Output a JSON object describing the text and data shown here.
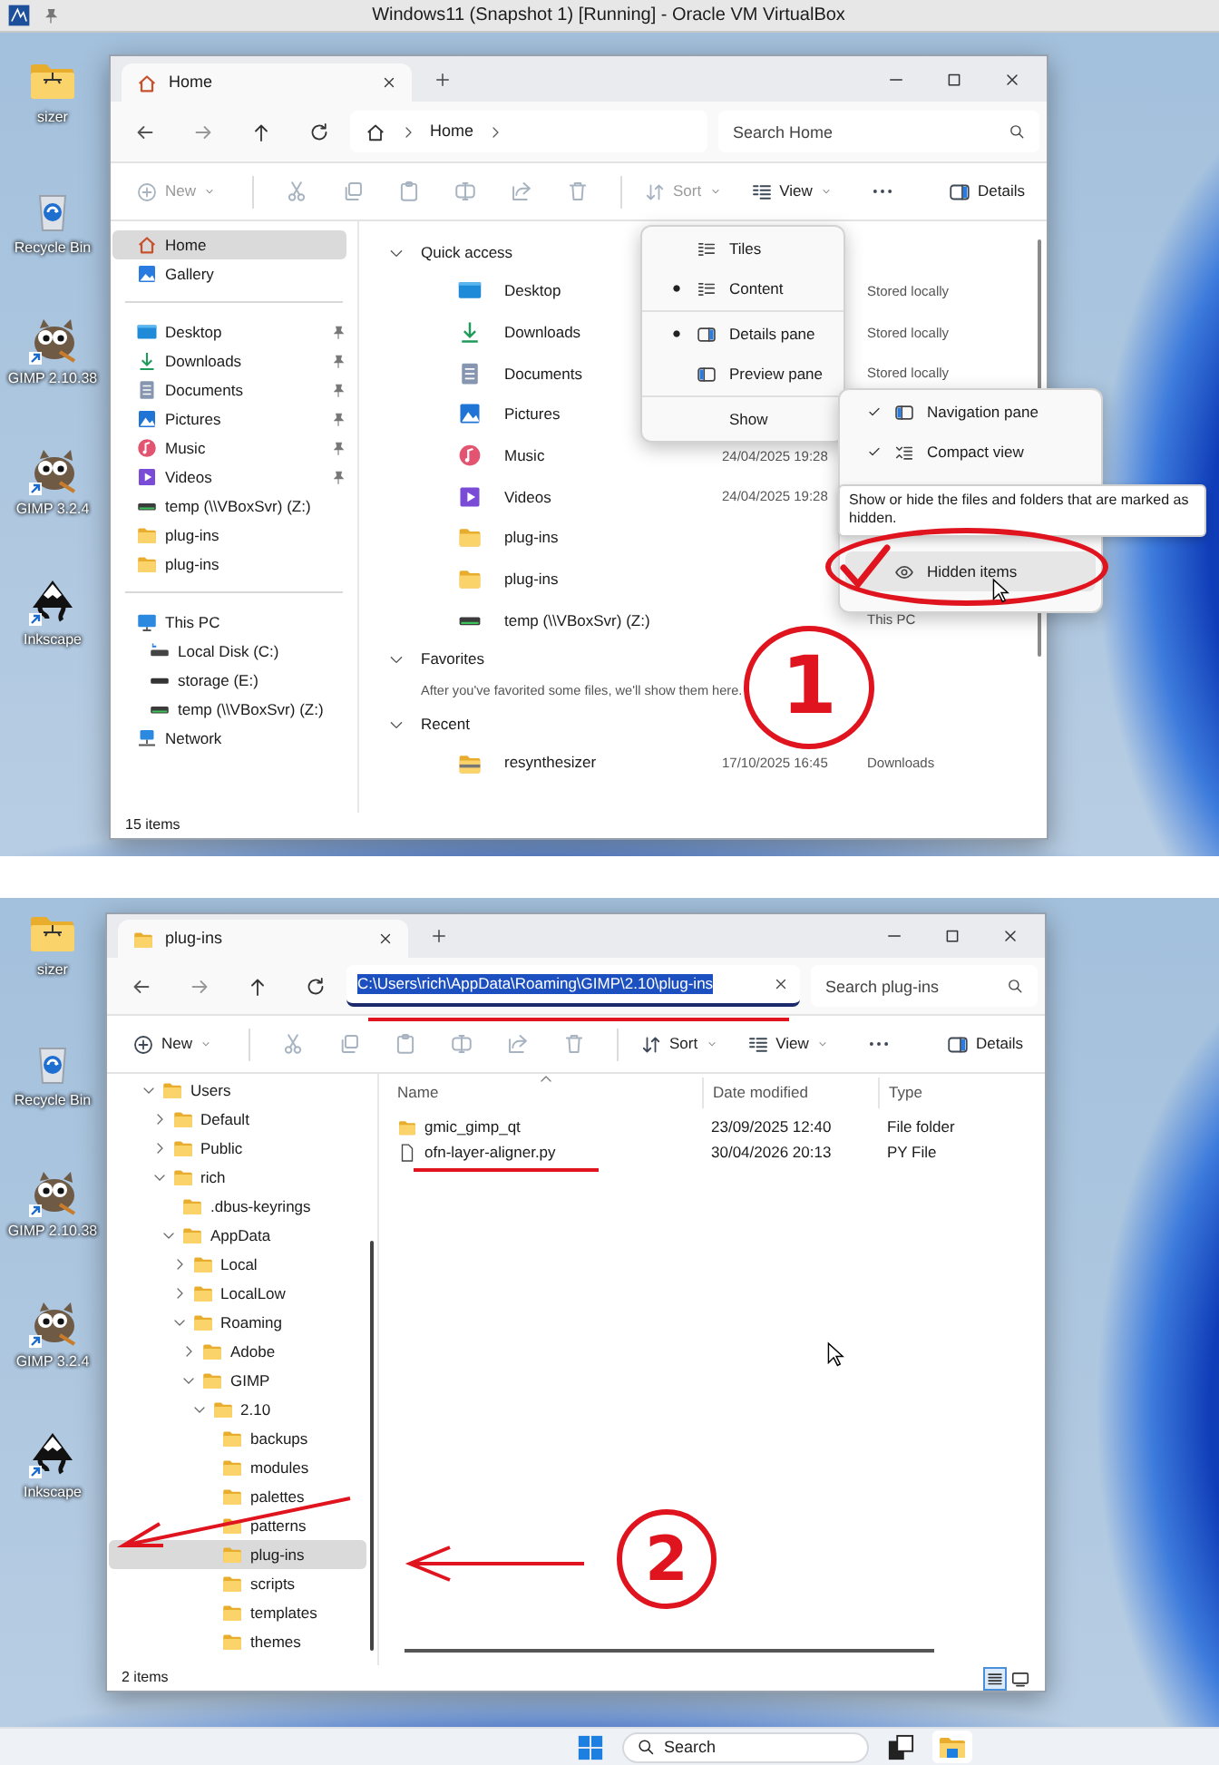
{
  "vm_window": {
    "title": "Windows11 (Snapshot 1) [Running] - Oracle VM VirtualBox"
  },
  "screens": [
    {
      "desktop_icons": [
        {
          "label": "sizer",
          "kind": "bigfolder"
        },
        {
          "label": "Recycle Bin",
          "kind": "recycle"
        },
        {
          "label": "GIMP 2.10.38",
          "kind": "mascot"
        },
        {
          "label": "GIMP 3.2.4",
          "kind": "mascot"
        },
        {
          "label": "Inkscape",
          "kind": "mountain"
        }
      ],
      "explorer": {
        "tab": {
          "label": "Home",
          "kind": "home"
        },
        "address": {
          "kind": "breadcrumb",
          "crumbs": [
            "Home"
          ]
        },
        "search": {
          "placeholder": "Search Home"
        },
        "commands": [
          {
            "kind": "new",
            "label": "New",
            "disabled": true
          },
          {
            "kind": "cut",
            "disabled": true
          },
          {
            "kind": "copy",
            "disabled": true
          },
          {
            "kind": "paste",
            "disabled": true
          },
          {
            "kind": "rename",
            "disabled": true
          },
          {
            "kind": "share",
            "disabled": true
          },
          {
            "kind": "delete",
            "disabled": true
          },
          {
            "kind": "sort",
            "label": "Sort",
            "disabled": true
          },
          {
            "kind": "view",
            "label": "View",
            "disabled": false
          },
          {
            "kind": "more",
            "disabled": false
          },
          {
            "kind": "details",
            "label": "Details",
            "disabled": false
          }
        ],
        "nav_groups": [
          [
            {
              "label": "Home",
              "kind": "home",
              "selected": true
            },
            {
              "label": "Gallery",
              "kind": "gallery",
              "selected": false
            }
          ],
          [
            {
              "label": "Desktop",
              "kind": "desktop",
              "pinned": true,
              "selected": false
            },
            {
              "label": "Downloads",
              "kind": "downloads",
              "pinned": true,
              "selected": false
            },
            {
              "label": "Documents",
              "kind": "documents",
              "pinned": true,
              "selected": false
            },
            {
              "label": "Pictures",
              "kind": "pictures",
              "pinned": true,
              "selected": false
            },
            {
              "label": "Music",
              "kind": "music",
              "pinned": true,
              "selected": false
            },
            {
              "label": "Videos",
              "kind": "videos",
              "pinned": true,
              "selected": false
            },
            {
              "label": "temp (\\\\VBoxSvr) (Z:)",
              "kind": "netdrive",
              "pinned": false,
              "selected": false
            },
            {
              "label": "plug-ins",
              "kind": "folder",
              "pinned": false,
              "selected": false
            },
            {
              "label": "plug-ins",
              "kind": "folder",
              "pinned": false,
              "selected": false
            }
          ],
          [
            {
              "label": "This PC",
              "kind": "pc",
              "selected": false,
              "children": [
                {
                  "label": "Local Disk (C:)",
                  "kind": "disk",
                  "selected": false
                },
                {
                  "label": "storage (E:)",
                  "kind": "drive",
                  "selected": false
                },
                {
                  "label": "temp (\\\\VBoxSvr) (Z:)",
                  "kind": "netdrive",
                  "selected": false
                }
              ]
            },
            {
              "label": "Network",
              "kind": "network",
              "selected": false
            }
          ]
        ],
        "content": {
          "kind": "sections",
          "sections": [
            {
              "title": "Quick access",
              "expanded": true,
              "rows": [
                {
                  "name": "Desktop",
                  "kind": "desktop",
                  "location": "Stored locally"
                },
                {
                  "name": "Downloads",
                  "kind": "downloads",
                  "location": "Stored locally"
                },
                {
                  "name": "Documents",
                  "kind": "documents",
                  "location": "Stored locally"
                },
                {
                  "name": "Pictures",
                  "kind": "pictures"
                },
                {
                  "name": "Music",
                  "kind": "music",
                  "date": "24/04/2025 19:28"
                },
                {
                  "name": "Videos",
                  "kind": "videos",
                  "date": "24/04/2025 19:28"
                },
                {
                  "name": "plug-ins",
                  "kind": "folder"
                },
                {
                  "name": "plug-ins",
                  "kind": "folder"
                },
                {
                  "name": "temp (\\\\VBoxSvr) (Z:)",
                  "kind": "netdrive",
                  "location": "This PC"
                }
              ]
            },
            {
              "title": "Favorites",
              "expanded": true,
              "message": "After you've favorited some files, we'll show them here."
            },
            {
              "title": "Recent",
              "expanded": true,
              "rows": [
                {
                  "name": "resynthesizer",
                  "kind": "zipfolder",
                  "date": "17/10/2025 16:45",
                  "location": "Downloads"
                }
              ]
            }
          ]
        },
        "status": "15 items"
      },
      "view_menu": {
        "groups": [
          [
            {
              "label": "Tiles",
              "kind": "tiles",
              "selected": false
            },
            {
              "label": "Content",
              "kind": "content",
              "selected": true
            }
          ],
          [
            {
              "label": "Details pane",
              "kind": "details-pane",
              "selected": true
            },
            {
              "label": "Preview pane",
              "kind": "preview-pane",
              "selected": false
            }
          ]
        ],
        "show": "Show"
      },
      "show_submenu": {
        "items": [
          {
            "label": "Navigation pane",
            "kind": "nav-pane",
            "checked": true,
            "highlighted": false
          },
          {
            "label": "Compact view",
            "kind": "compact",
            "checked": true,
            "highlighted": false
          },
          {
            "label": "Hidden items",
            "kind": "hidden",
            "checked": false,
            "highlighted": true
          }
        ],
        "tooltip": "Show or hide the files and folders that are marked as hidden."
      },
      "annotation": {
        "number": "1"
      }
    },
    {
      "desktop_icons": [
        {
          "label": "sizer",
          "kind": "bigfolder"
        },
        {
          "label": "Recycle Bin",
          "kind": "recycle"
        },
        {
          "label": "GIMP 2.10.38",
          "kind": "mascot"
        },
        {
          "label": "GIMP 3.2.4",
          "kind": "mascot"
        },
        {
          "label": "Inkscape",
          "kind": "mountain"
        }
      ],
      "explorer": {
        "tab": {
          "label": "plug-ins",
          "kind": "folder"
        },
        "address": {
          "kind": "path",
          "value": "C:\\Users\\rich\\AppData\\Roaming\\GIMP\\2.10\\plug-ins",
          "selected": true
        },
        "search": {
          "placeholder": "Search plug-ins"
        },
        "commands": [
          {
            "kind": "new",
            "label": "New",
            "disabled": false
          },
          {
            "kind": "cut",
            "disabled": true
          },
          {
            "kind": "copy",
            "disabled": true
          },
          {
            "kind": "paste",
            "disabled": true
          },
          {
            "kind": "rename",
            "disabled": true
          },
          {
            "kind": "share",
            "disabled": true
          },
          {
            "kind": "delete",
            "disabled": true
          },
          {
            "kind": "sort",
            "label": "Sort",
            "disabled": false
          },
          {
            "kind": "view",
            "label": "View",
            "disabled": false
          },
          {
            "kind": "more",
            "disabled": false
          },
          {
            "kind": "details",
            "label": "Details",
            "disabled": false
          }
        ],
        "nav_tree": [
          {
            "label": "Users",
            "kind": "folder",
            "expanded": true,
            "selected": false,
            "children": [
              {
                "label": "Default",
                "kind": "folder",
                "expanded": false,
                "selected": false
              },
              {
                "label": "Public",
                "kind": "folder",
                "expanded": false,
                "selected": false
              },
              {
                "label": "rich",
                "kind": "folder",
                "expanded": true,
                "selected": false,
                "children": [
                  {
                    "label": ".dbus-keyrings",
                    "kind": "folder",
                    "selected": false
                  },
                  {
                    "label": "AppData",
                    "kind": "folder",
                    "expanded": true,
                    "selected": false,
                    "children": [
                      {
                        "label": "Local",
                        "kind": "folder",
                        "expanded": false,
                        "selected": false
                      },
                      {
                        "label": "LocalLow",
                        "kind": "folder",
                        "expanded": false,
                        "selected": false
                      },
                      {
                        "label": "Roaming",
                        "kind": "folder",
                        "expanded": true,
                        "selected": false,
                        "children": [
                          {
                            "label": "Adobe",
                            "kind": "folder",
                            "expanded": false,
                            "selected": false
                          },
                          {
                            "label": "GIMP",
                            "kind": "folder",
                            "expanded": true,
                            "selected": false,
                            "children": [
                              {
                                "label": "2.10",
                                "kind": "folder",
                                "expanded": true,
                                "selected": false,
                                "children": [
                                  {
                                    "label": "backups",
                                    "kind": "folder",
                                    "selected": false
                                  },
                                  {
                                    "label": "modules",
                                    "kind": "folder",
                                    "selected": false
                                  },
                                  {
                                    "label": "palettes",
                                    "kind": "folder",
                                    "selected": false
                                  },
                                  {
                                    "label": "patterns",
                                    "kind": "folder",
                                    "selected": false
                                  },
                                  {
                                    "label": "plug-ins",
                                    "kind": "folder",
                                    "selected": true
                                  },
                                  {
                                    "label": "scripts",
                                    "kind": "folder",
                                    "selected": false
                                  },
                                  {
                                    "label": "templates",
                                    "kind": "folder",
                                    "selected": false
                                  },
                                  {
                                    "label": "themes",
                                    "kind": "folder",
                                    "selected": false
                                  }
                                ]
                              }
                            ]
                          }
                        ]
                      }
                    ]
                  }
                ]
              }
            ]
          }
        ],
        "content": {
          "kind": "details",
          "columns": [
            "Name",
            "Date modified",
            "Type"
          ],
          "rows": [
            {
              "name": "gmic_gimp_qt",
              "kind": "folder",
              "date": "23/09/2025 12:40",
              "type": "File folder"
            },
            {
              "name": "ofn-layer-aligner.py",
              "kind": "file",
              "date": "30/04/2026 20:13",
              "type": "PY File"
            }
          ]
        },
        "status": "2 items",
        "view_toggles": [
          {
            "kind": "details-view",
            "selected": true
          },
          {
            "kind": "tiles-view",
            "selected": false
          }
        ]
      },
      "taskbar": {
        "search_placeholder": "Search"
      },
      "annotation": {
        "number": "2"
      }
    }
  ]
}
